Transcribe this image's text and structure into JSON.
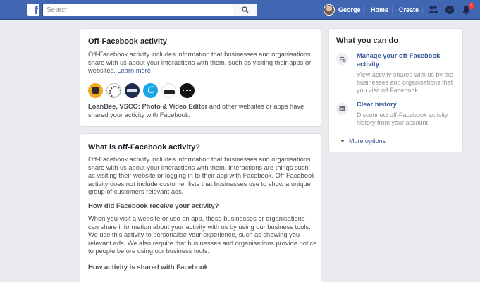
{
  "topbar": {
    "logo": "f",
    "search_placeholder": "Search",
    "user": "George",
    "home": "Home",
    "create": "Create",
    "notification_count": "1",
    "icons": [
      "facebook-logo-icon",
      "search-icon",
      "friends-icon",
      "messenger-icon",
      "bell-icon"
    ]
  },
  "off_facebook": {
    "title": "Off-Facebook activity",
    "description": "Off-Facebook activity includes information that businesses and organisations share with us about your interactions with them, such as visiting their apps or websites.",
    "learn_more": "Learn more",
    "apps_bold": "LoanBee, VSCO: Photo & Video Editor",
    "apps_rest": " and other websites or apps have shared your activity with Facebook."
  },
  "what_is": {
    "title": "What is off-Facebook activity?",
    "body": "Off-Facebook activity includes information that businesses and organisations share with us about your interactions with them. Interactions are things such as visiting their website or logging in to their app with Facebook. Off-Facebook activity does not include customer lists that businesses use to show a unique group of customers relevant ads.",
    "how_title": "How did Facebook receive your activity?",
    "how_body": "When you visit a website or use an app, these businesses or organisations can share information about your activity with us by using our business tools. We use this activity to personalise your experience, such as showing you relevant ads. We also require that businesses and organisations provide notice to people before using our business tools.",
    "shared_title": "How activity is shared with Facebook"
  },
  "sidebar": {
    "title": "What you can do",
    "items": [
      {
        "title": "Manage your off-Facebook activity",
        "desc": "View activity shared with us by the businesses and organisations that you visit off Facebook.",
        "icon": "manage-activity-icon"
      },
      {
        "title": "Clear history",
        "desc": "Disconnect off-Facebook activity history from your account.",
        "icon": "clear-history-icon"
      }
    ],
    "more": "More options"
  },
  "colors": {
    "brand": "#4267b2",
    "link": "#385898",
    "background": "#e9ebee"
  }
}
